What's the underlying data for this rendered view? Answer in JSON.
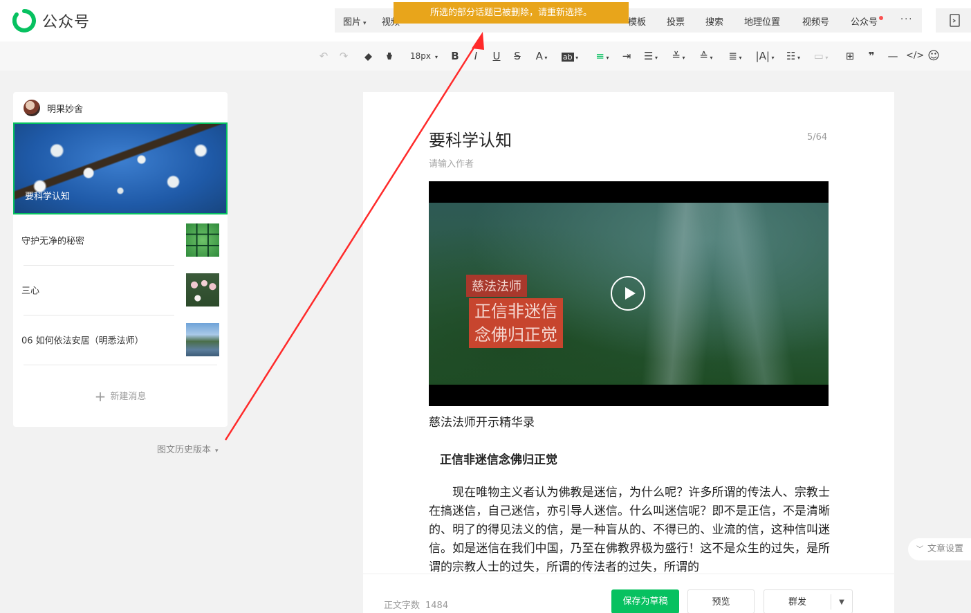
{
  "app": {
    "name": "公众号"
  },
  "toast": {
    "message": "所选的部分话题已被删除，请重新选择。"
  },
  "insert_menu": [
    {
      "label": "图片",
      "caret": true
    },
    {
      "label": "视频",
      "caret": false
    },
    {
      "label": "模板",
      "caret": false
    },
    {
      "label": "投票",
      "caret": false
    },
    {
      "label": "搜索",
      "caret": false
    },
    {
      "label": "地理位置",
      "caret": false
    },
    {
      "label": "视频号",
      "caret": false
    },
    {
      "label": "公众号",
      "caret": false,
      "badge": true
    },
    {
      "label": "···",
      "caret": false
    }
  ],
  "toolbar": {
    "font_size": "18px"
  },
  "account": {
    "name": "明果妙舍"
  },
  "articles": {
    "cover": {
      "title": "要科学认知"
    },
    "items": [
      {
        "title": "守护无净的秘密",
        "thumb": "green-dominant"
      },
      {
        "title": "三心",
        "thumb": "lotus"
      },
      {
        "title": "06 如何依法安居（明悉法师）",
        "thumb": "landscape"
      }
    ],
    "new_message": "新建消息",
    "history": "图文历史版本"
  },
  "editor": {
    "title": "要科学认知",
    "title_count": "5/64",
    "author_placeholder": "请输入作者",
    "video": {
      "label_top": "慈法法师",
      "label_main_1": "正信非迷信",
      "label_main_2": "念佛归正觉"
    },
    "caption": "慈法法师开示精华录",
    "subheading": "正信非迷信念佛归正觉",
    "body": "现在唯物主义者认为佛教是迷信，为什么呢？许多所谓的传法人、宗教士在搞迷信，自己迷信，亦引导人迷信。什么叫迷信呢？即不是正信，不是清晰的、明了的得见法义的信，是一种盲从的、不得已的、业流的信，这种信叫迷信。如是迷信在我们中国，乃至在佛教界极为盛行！这不是众生的过失，是所谓的宗教人士的过失，所谓的传法者的过失，所谓的"
  },
  "bottom": {
    "word_count_label": "正文字数",
    "word_count": "1484",
    "save_draft": "保存为草稿",
    "preview": "预览",
    "publish": "群发"
  },
  "side": {
    "article_settings": "文章设置"
  },
  "colors": {
    "accent": "#07c160",
    "toast": "#e8a51b",
    "annotation": "#ff2a2a"
  }
}
